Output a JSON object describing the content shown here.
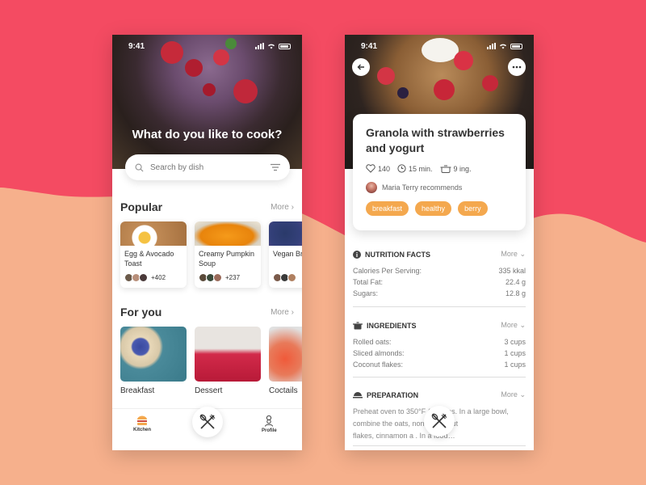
{
  "colors": {
    "background_pink": "#f44b62",
    "background_peach": "#f6b08c",
    "tag_orange": "#f4a84e"
  },
  "status_bar": {
    "time": "9:41"
  },
  "kitchen_screen": {
    "hero_title": "What do you like to cook?",
    "search": {
      "placeholder": "Search by dish"
    },
    "popular": {
      "title": "Popular",
      "more": "More",
      "cards": [
        {
          "name": "Egg & Avocado Toast",
          "count": "+402"
        },
        {
          "name": "Creamy Pumpkin Soup",
          "count": "+237"
        },
        {
          "name": "Vegan Breakfast",
          "count": ""
        }
      ]
    },
    "for_you": {
      "title": "For you",
      "more": "More",
      "items": [
        {
          "label": "Breakfast"
        },
        {
          "label": "Dessert"
        },
        {
          "label": "Coctails"
        }
      ]
    },
    "tabs": {
      "kitchen": "Kitchen",
      "profile": "Profile"
    }
  },
  "recipe_screen": {
    "title": "Granola with strawberries and yogurt",
    "likes": "140",
    "time": "15 min.",
    "ingredients_count": "9 ing.",
    "recommender": "Maria Terry recommends",
    "tags": [
      "breakfast",
      "healthy",
      "berry"
    ],
    "nutrition": {
      "title": "NUTRITION FACTS",
      "more": "More",
      "rows": [
        {
          "label": "Calories Per Serving:",
          "value": "335 kkal"
        },
        {
          "label": "Total Fat:",
          "value": "22.4 g"
        },
        {
          "label": "Sugars:",
          "value": "12.8 g"
        }
      ]
    },
    "ingredients": {
      "title": "INGREDIENTS",
      "more": "More",
      "rows": [
        {
          "label": "Rolled oats:",
          "value": "3 cups"
        },
        {
          "label": "Sliced almonds:",
          "value": "1 cups"
        },
        {
          "label": "Coconut flakes:",
          "value": "1 cups"
        }
      ]
    },
    "preparation": {
      "title": "PREPARATION",
      "more": "More",
      "text_lines": [
        "Preheat oven to 350°F (17… es. In a large bowl,",
        "combine the oats,          nond, coconut",
        "flakes, cinnamon a          . In a food…"
      ]
    }
  }
}
